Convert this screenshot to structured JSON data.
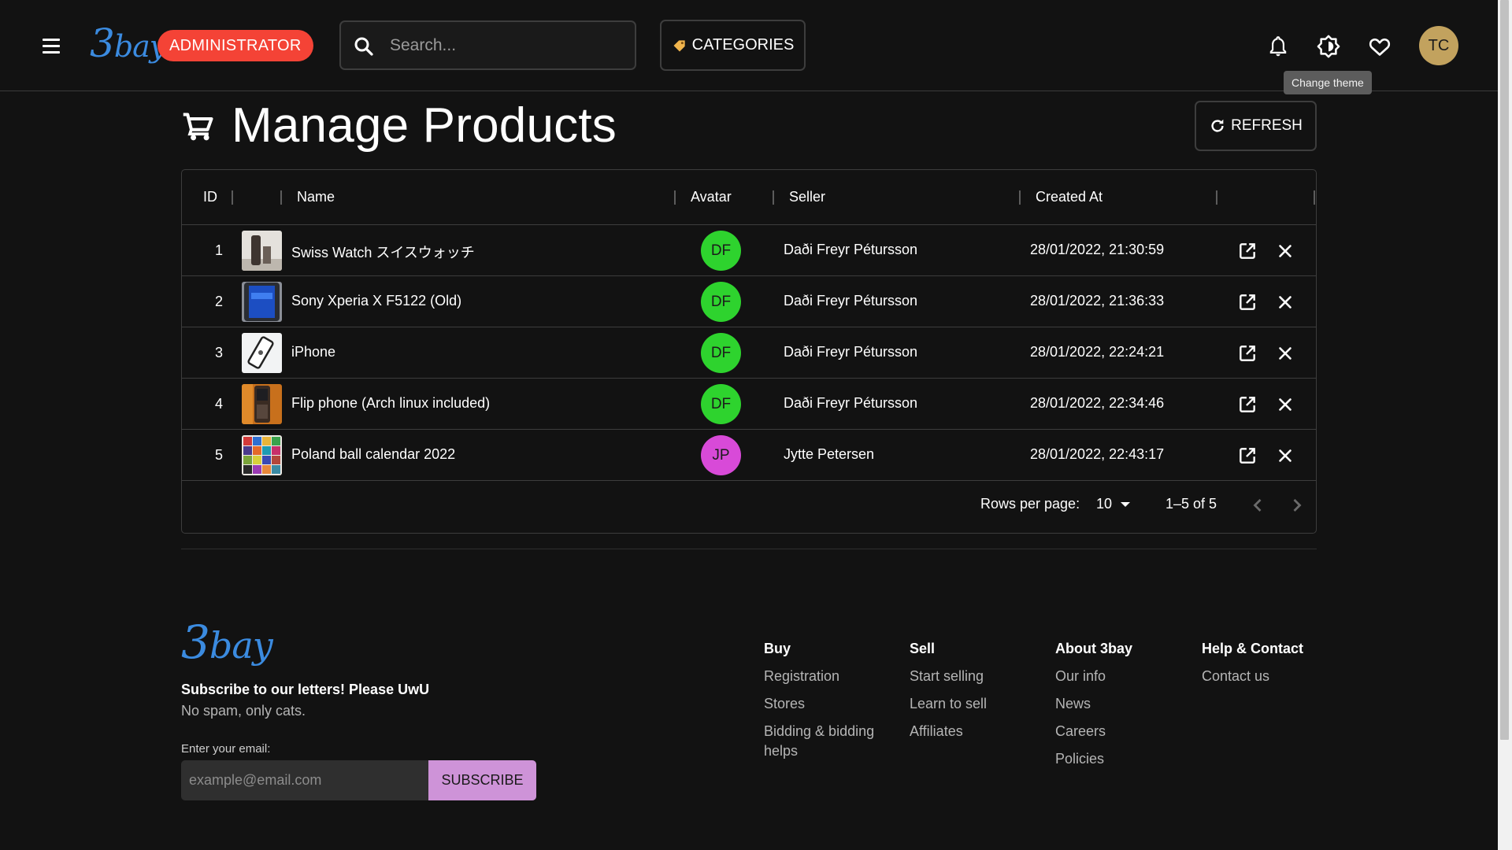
{
  "header": {
    "logo_text": "3bay",
    "role_badge": "ADMINISTRATOR",
    "search_placeholder": "Search...",
    "categories_label": "CATEGORIES",
    "avatar_initials": "TC",
    "tooltip": "Change theme",
    "icons": [
      "menu-icon",
      "search-icon",
      "tag-icon",
      "bell-icon",
      "theme-icon",
      "heart-icon"
    ]
  },
  "page": {
    "title": "Manage Products",
    "refresh_label": "REFRESH"
  },
  "table": {
    "columns": [
      "ID",
      "Name",
      "Avatar",
      "Seller",
      "Created At"
    ],
    "rows": [
      {
        "id": "1",
        "name": "Swiss Watch スイスウォッチ",
        "avatar": "DF",
        "avatar_color": "#2ed32e",
        "seller": "Daði Freyr Pétursson",
        "created_at": "28/01/2022, 21:30:59"
      },
      {
        "id": "2",
        "name": "Sony Xperia X F5122 (Old)",
        "avatar": "DF",
        "avatar_color": "#2ed32e",
        "seller": "Daði Freyr Pétursson",
        "created_at": "28/01/2022, 21:36:33"
      },
      {
        "id": "3",
        "name": "iPhone",
        "avatar": "DF",
        "avatar_color": "#2ed32e",
        "seller": "Daði Freyr Pétursson",
        "created_at": "28/01/2022, 22:24:21"
      },
      {
        "id": "4",
        "name": "Flip phone (Arch linux included)",
        "avatar": "DF",
        "avatar_color": "#2ed32e",
        "seller": "Daði Freyr Pétursson",
        "created_at": "28/01/2022, 22:34:46"
      },
      {
        "id": "5",
        "name": "Poland ball calendar 2022",
        "avatar": "JP",
        "avatar_color": "#d84ad8",
        "seller": "Jytte Petersen",
        "created_at": "28/01/2022, 22:43:17"
      }
    ],
    "rows_per_page_label": "Rows per page:",
    "rows_per_page_value": "10",
    "range_text": "1–5 of 5"
  },
  "footer": {
    "logo_text": "3bay",
    "subscribe_title": "Subscribe to our letters! Please UwU",
    "subscribe_text": "No spam, only cats.",
    "email_label": "Enter your email:",
    "email_placeholder": "example@email.com",
    "subscribe_button": "SUBSCRIBE",
    "columns": [
      {
        "heading": "Buy",
        "links": [
          "Registration",
          "Stores",
          "Bidding & bidding helps"
        ]
      },
      {
        "heading": "Sell",
        "links": [
          "Start selling",
          "Learn to sell",
          "Affiliates"
        ]
      },
      {
        "heading": "About 3bay",
        "links": [
          "Our info",
          "News",
          "Careers",
          "Policies"
        ]
      },
      {
        "heading": "Help & Contact",
        "links": [
          "Contact us"
        ]
      }
    ]
  },
  "colors": {
    "accent_logo": "#3b8be0",
    "badge": "#f44336",
    "subscribe": "#ce93d8",
    "avatar_top": "#c2a25e"
  }
}
